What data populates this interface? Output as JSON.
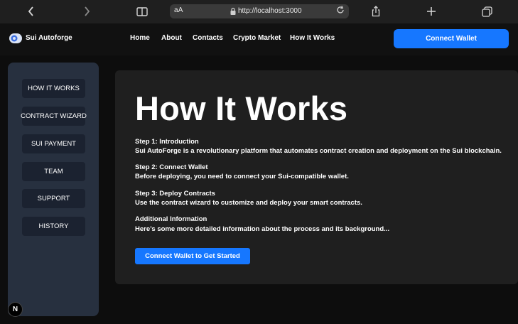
{
  "browser": {
    "url_text_size": "aA",
    "url": "http://localhost:3000",
    "icons": {
      "back": "chevron-left-icon",
      "forward": "chevron-right-icon",
      "bookmarks": "book-icon",
      "reload": "reload-icon",
      "share": "share-icon",
      "new_tab": "plus-icon",
      "tabs": "tabs-icon"
    }
  },
  "navbar": {
    "logo_text": "Sui Autoforge",
    "links": [
      "Home",
      "About",
      "Contacts",
      "Crypto Market",
      "How It Works"
    ],
    "connect_label": "Connect Wallet",
    "accent": "#1677ff"
  },
  "sidebar": {
    "items": [
      "HOW IT WORKS",
      "CONTRACT WIZARD",
      "SUI PAYMENT",
      "TEAM",
      "SUPPORT",
      "HISTORY"
    ]
  },
  "badge": {
    "label": "N"
  },
  "main": {
    "title": "How It Works",
    "sections": [
      {
        "heading": "Step 1: Introduction",
        "text": "Sui AutoForge is a revolutionary platform that automates contract creation and deployment on the Sui blockchain."
      },
      {
        "heading": "Step 2: Connect Wallet",
        "text": "Before deploying, you need to connect your Sui-compatible wallet."
      },
      {
        "heading": "Step 3: Deploy Contracts",
        "text": "Use the contract wizard to customize and deploy your smart contracts."
      },
      {
        "heading": "Additional Information",
        "text": "Here’s some more detailed information about the process and its background..."
      }
    ],
    "cta_label": "Connect Wallet to Get Started"
  }
}
